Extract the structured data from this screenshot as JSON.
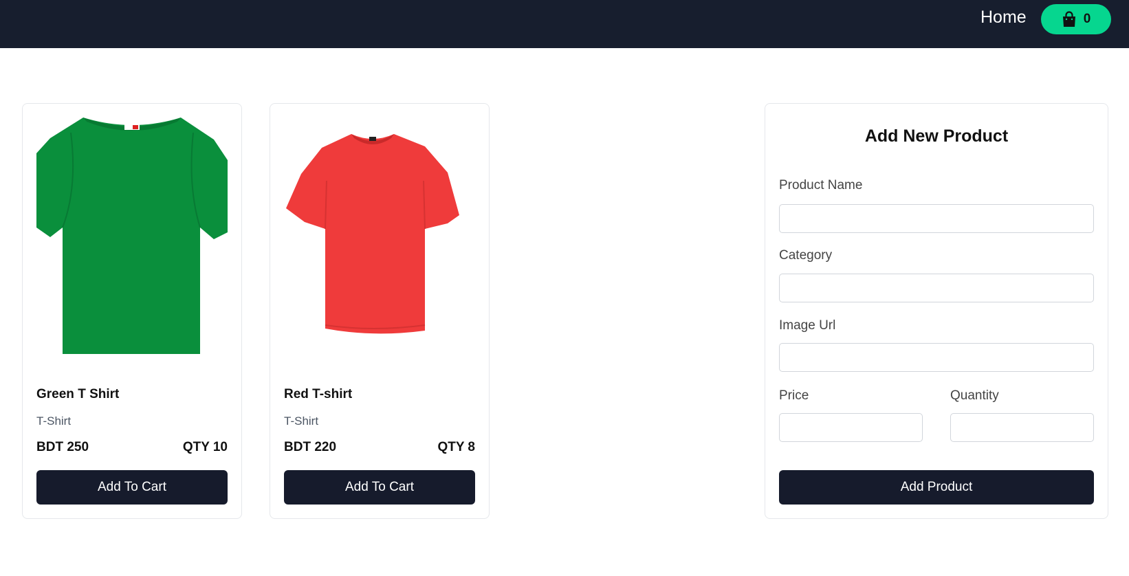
{
  "nav": {
    "home_label": "Home",
    "cart_icon": "shopping-bag-icon",
    "cart_count": "0",
    "background": "#171e2e",
    "cart_color": "#06d68f"
  },
  "products": [
    {
      "name": "Green T Shirt",
      "category": "T-Shirt",
      "price": "BDT 250",
      "qty": "QTY 10",
      "image_icon": "green-tshirt-image",
      "color": "#0a8f3c",
      "button_label": "Add To Cart"
    },
    {
      "name": "Red T-shirt",
      "category": "T-Shirt",
      "price": "BDT 220",
      "qty": "QTY 8",
      "image_icon": "red-tshirt-image",
      "color": "#ef3b3b",
      "button_label": "Add To Cart"
    }
  ],
  "form": {
    "title": "Add New Product",
    "fields": {
      "name": {
        "label": "Product Name",
        "value": ""
      },
      "category": {
        "label": "Category",
        "value": ""
      },
      "image": {
        "label": "Image Url",
        "value": ""
      },
      "price": {
        "label": "Price",
        "value": ""
      },
      "quantity": {
        "label": "Quantity",
        "value": ""
      }
    },
    "submit_label": "Add Product",
    "button_color": "#161b2c"
  }
}
